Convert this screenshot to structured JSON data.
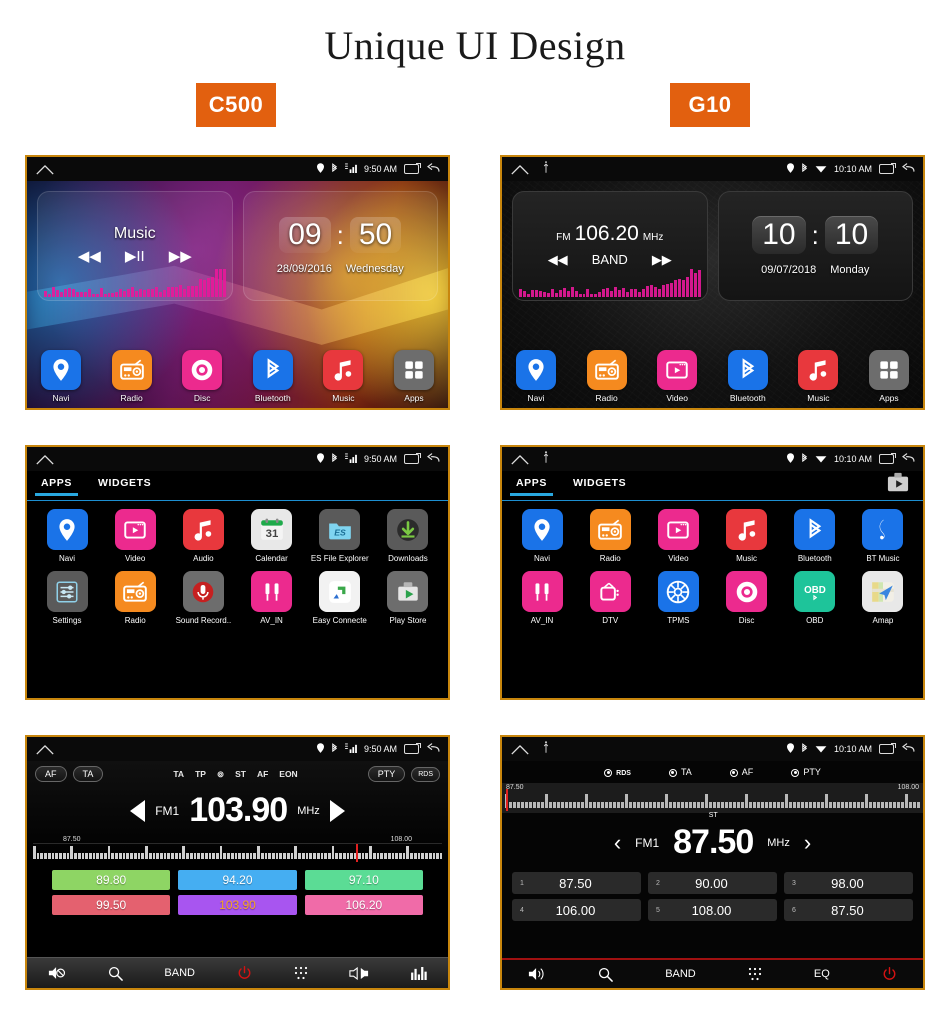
{
  "page": {
    "title": "Unique UI Design"
  },
  "badges": {
    "left": "C500",
    "right": "G10"
  },
  "c500": {
    "status": {
      "time": "9:50 AM",
      "icons": [
        "location-icon",
        "bluetooth-icon",
        "signal-icon",
        "recents-icon",
        "back-icon"
      ]
    },
    "home": {
      "music_widget": {
        "title": "Music",
        "prev": "◀◀",
        "play": "▶II",
        "next": "▶▶"
      },
      "clock_widget": {
        "hours": "09",
        "colon": ":",
        "minutes": "50",
        "date": "28/09/2016",
        "weekday": "Wednesday"
      },
      "dock": [
        {
          "label": "Navi",
          "icon": "location-pin-icon",
          "color": "#1a73e8"
        },
        {
          "label": "Radio",
          "icon": "radio-icon",
          "color": "#f58a1f"
        },
        {
          "label": "Disc",
          "icon": "disc-icon",
          "color": "#ec2a8e"
        },
        {
          "label": "Bluetooth",
          "icon": "bluetooth-icon",
          "color": "#1a73e8"
        },
        {
          "label": "Music",
          "icon": "music-note-icon",
          "color": "#e8383d"
        },
        {
          "label": "Apps",
          "icon": "grid-apps-icon",
          "color": "#6d6d6d"
        }
      ]
    },
    "apps": {
      "tabs": [
        {
          "label": "APPS",
          "active": true
        },
        {
          "label": "WIDGETS",
          "active": false
        }
      ],
      "row1": [
        {
          "label": "Navi",
          "icon": "location-pin-icon",
          "color": "#1a73e8"
        },
        {
          "label": "Video",
          "icon": "video-icon",
          "color": "#ec2a8e"
        },
        {
          "label": "Audio",
          "icon": "music-note-icon",
          "color": "#e8383d"
        },
        {
          "label": "Calendar",
          "icon": "calendar-icon",
          "color": "#e8e8e8"
        },
        {
          "label": "ES File Explorer",
          "icon": "es-folder-icon",
          "color": "#5a5a5a"
        },
        {
          "label": "Downloads",
          "icon": "download-icon",
          "color": "#5a5a5a"
        }
      ],
      "row2": [
        {
          "label": "Settings",
          "icon": "settings-sliders-icon",
          "color": "#5a5a5a"
        },
        {
          "label": "Radio",
          "icon": "radio-icon",
          "color": "#f58a1f"
        },
        {
          "label": "Sound Record..",
          "icon": "microphone-icon",
          "color": "#6d6d6d"
        },
        {
          "label": "AV_IN",
          "icon": "rca-plugs-icon",
          "color": "#ec2a8e"
        },
        {
          "label": "Easy Connecte",
          "icon": "easy-connect-icon",
          "color": "#f2f2f2"
        },
        {
          "label": "Play Store",
          "icon": "play-store-icon",
          "color": "#6d6d6d"
        }
      ]
    },
    "radio": {
      "left_pills": [
        "AF",
        "TA"
      ],
      "mid_flags": [
        "TA",
        "TP",
        "⊚",
        "ST",
        "AF",
        "EON"
      ],
      "right_pills": [
        "PTY",
        "RDS"
      ],
      "band": "FM1",
      "frequency": "103.90",
      "unit": "MHz",
      "scale_min": "87.50",
      "scale_max": "108.00",
      "presets": [
        {
          "value": "89.80",
          "color": "#8ED564"
        },
        {
          "value": "94.20",
          "color": "#45AEF2"
        },
        {
          "value": "97.10",
          "color": "#5BDC95"
        },
        {
          "value": "99.50",
          "color": "#E4616F"
        },
        {
          "value": "103.90",
          "color": "#A855F0",
          "text_color": "#f5a623"
        },
        {
          "value": "106.20",
          "color": "#F06BA8"
        }
      ],
      "toolbar": [
        {
          "label": "",
          "icon": "mute-icon"
        },
        {
          "label": "",
          "icon": "search-icon"
        },
        {
          "label": "BAND",
          "icon": "band-label"
        },
        {
          "label": "",
          "icon": "power-icon"
        },
        {
          "label": "",
          "icon": "keypad-icon"
        },
        {
          "label": "",
          "icon": "balance-icon"
        },
        {
          "label": "",
          "icon": "equalizer-icon"
        }
      ]
    }
  },
  "g10": {
    "status": {
      "time": "10:10 AM",
      "icons": [
        "usb-icon",
        "location-icon",
        "bluetooth-icon",
        "wifi-icon",
        "recents-icon",
        "back-icon"
      ]
    },
    "home": {
      "radio_widget": {
        "band": "FM",
        "frequency": "106.20",
        "unit": "MHz",
        "prev": "◀◀",
        "band_button": "BAND",
        "next": "▶▶"
      },
      "clock_widget": {
        "hours": "10",
        "colon": ":",
        "minutes": "10",
        "date": "09/07/2018",
        "weekday": "Monday"
      },
      "dock": [
        {
          "label": "Navi",
          "icon": "location-pin-icon",
          "color": "#1a73e8"
        },
        {
          "label": "Radio",
          "icon": "radio-icon",
          "color": "#f58a1f"
        },
        {
          "label": "Video",
          "icon": "video-icon",
          "color": "#ec2a8e"
        },
        {
          "label": "Bluetooth",
          "icon": "bluetooth-icon",
          "color": "#1a73e8"
        },
        {
          "label": "Music",
          "icon": "music-note-icon",
          "color": "#e8383d"
        },
        {
          "label": "Apps",
          "icon": "grid-apps-icon",
          "color": "#6d6d6d"
        }
      ]
    },
    "apps": {
      "tabs": [
        {
          "label": "APPS",
          "active": true
        },
        {
          "label": "WIDGETS",
          "active": false
        }
      ],
      "corner_icon": "play-store-icon",
      "row1": [
        {
          "label": "Navi",
          "icon": "location-pin-icon",
          "color": "#1a73e8"
        },
        {
          "label": "Radio",
          "icon": "radio-icon",
          "color": "#f58a1f"
        },
        {
          "label": "Video",
          "icon": "video-icon",
          "color": "#ec2a8e"
        },
        {
          "label": "Music",
          "icon": "music-note-icon",
          "color": "#e8383d"
        },
        {
          "label": "Bluetooth",
          "icon": "bluetooth-icon",
          "color": "#1a73e8"
        },
        {
          "label": "BT Music",
          "icon": "treble-clef-icon",
          "color": "#1a73e8"
        }
      ],
      "row2": [
        {
          "label": "AV_IN",
          "icon": "rca-plugs-icon",
          "color": "#ec2a8e"
        },
        {
          "label": "DTV",
          "icon": "tv-icon",
          "color": "#ec2a8e"
        },
        {
          "label": "TPMS",
          "icon": "tire-icon",
          "color": "#1a73e8"
        },
        {
          "label": "Disc",
          "icon": "disc-icon",
          "color": "#ec2a8e"
        },
        {
          "label": "OBD",
          "icon": "obd-icon",
          "color": "#1ec49a"
        },
        {
          "label": "Amap",
          "icon": "amap-icon",
          "color": "#e8e8e8"
        }
      ]
    },
    "radio": {
      "flags": [
        "RDS",
        "TA",
        "AF",
        "PTY"
      ],
      "band": "FM1",
      "frequency": "87.50",
      "unit": "MHz",
      "stereo_label": "ST",
      "scale_min": "87.50",
      "scale_max": "108.00",
      "presets": [
        {
          "num": "1",
          "value": "87.50"
        },
        {
          "num": "2",
          "value": "90.00"
        },
        {
          "num": "3",
          "value": "98.00"
        },
        {
          "num": "4",
          "value": "106.00"
        },
        {
          "num": "5",
          "value": "108.00"
        },
        {
          "num": "6",
          "value": "87.50"
        }
      ],
      "toolbar": [
        {
          "label": "",
          "icon": "volume-icon"
        },
        {
          "label": "",
          "icon": "search-icon"
        },
        {
          "label": "BAND",
          "icon": "band-label"
        },
        {
          "label": "",
          "icon": "keypad-icon"
        },
        {
          "label": "EQ",
          "icon": "eq-label"
        },
        {
          "label": "",
          "icon": "power-icon"
        }
      ]
    }
  },
  "colors": {
    "frame": "#C8860D",
    "badge": "#E2600F",
    "accent_blue": "#29a8e0",
    "power_red": "#d41212"
  }
}
